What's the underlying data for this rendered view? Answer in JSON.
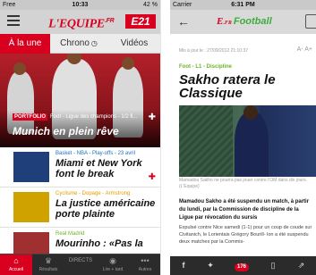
{
  "left_phone": {
    "status_bar": {
      "carrier": "Free",
      "time": "10:33",
      "battery": "42 %"
    },
    "header": {
      "logo": "L'EQUIPE",
      "logo_suffix": ".FR",
      "badge": "E21"
    },
    "tabs": [
      {
        "label": "À la une",
        "icon": ""
      },
      {
        "label": "Chrono",
        "icon": "chrono-icon"
      },
      {
        "label": "Vidéos",
        "icon": ""
      }
    ],
    "hero": {
      "tag": "PORTFOLIO",
      "category": "Foot - Ligue des champions - 1/2 fi...",
      "title": "Munich en plein rêve"
    },
    "items": [
      {
        "category": "Basket - NBA - Play-offs - 23 avril",
        "category_color": "#1e6fc0",
        "title": "Miami et New York font le break",
        "thumb_color": "#1f3f7a"
      },
      {
        "category": "Cyclisme - Dopage - Armstrong",
        "category_color": "#e0a000",
        "title": "La justice américaine porte plainte",
        "thumb_color": "#d0a200"
      },
      {
        "category": "Real Madrid",
        "category_color": "#6fb22b",
        "title": "Mourinho : «Pas la",
        "thumb_color": "#a03030"
      }
    ],
    "bottom_nav": [
      {
        "label": "Accueil",
        "icon": "home-icon"
      },
      {
        "label": "Résultats",
        "icon": "trophy-icon"
      },
      {
        "label": "DIRECTS",
        "icon": ""
      },
      {
        "label": "Lire + tard",
        "icon": "eye-icon"
      },
      {
        "label": "Autres",
        "icon": "more-icon"
      }
    ]
  },
  "right_phone": {
    "status_bar": {
      "carrier": "Carrier",
      "time": "6:31 PM"
    },
    "header": {
      "logo": "E",
      "logo_suffix": ".FR",
      "section": "Football"
    },
    "date": "Mis à jour le : 27/09/2012 21:10:37",
    "font_controls": "A- A+",
    "category": "Foot - L1 - Discipline",
    "title": "Sakho ratera le Classique",
    "caption": "Mamadou Sakho ne pourra pas jouer contre l'OM dans dix jours. (L'Equipe)",
    "lead": "Mamadou Sakho a été suspendu un match, à partir du lundi, par la Commission de discipline de la Ligue par révocation du sursis",
    "body": "Expulsé contre Nice samedi (1-1) pour un coup de coude sur Civitanich, le Lorientais Grégory Bourill- lon a été suspendu deux matches par la Commis-",
    "share_count": "176"
  }
}
